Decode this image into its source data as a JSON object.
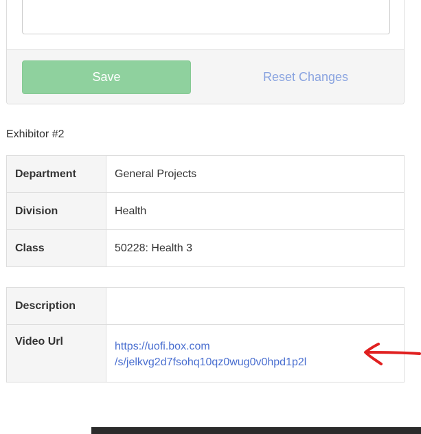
{
  "form": {
    "save_label": "Save",
    "reset_label": "Reset Changes"
  },
  "exhibitor": {
    "heading": "Exhibitor #2",
    "details": [
      {
        "label": "Department",
        "value": "General Projects"
      },
      {
        "label": "Division",
        "value": "Health"
      },
      {
        "label": "Class",
        "value": "50228: Health 3"
      }
    ],
    "description_label": "Description",
    "description_value": "",
    "video_url_label": "Video Url",
    "video_url_line1": "https://uofi.box.com",
    "video_url_line2": "/s/jelkvg2d7fsohq10qz0wug0v0hpd1p2l"
  },
  "colors": {
    "save_button": "#8fd19e",
    "link": "#4a6fd0",
    "annotation_arrow": "#e02020"
  },
  "icons": {
    "annotation": "red-arrow-icon"
  }
}
